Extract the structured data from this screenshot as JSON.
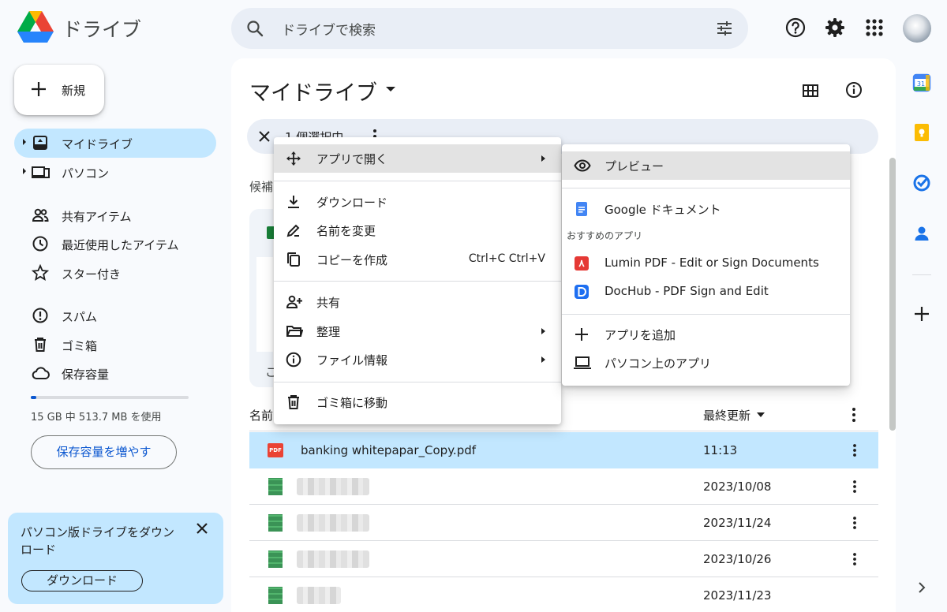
{
  "app": {
    "brand": "ドライブ"
  },
  "search": {
    "placeholder": "ドライブで検索"
  },
  "nav": {
    "new_label": "新規",
    "items": [
      {
        "label": "マイドライブ"
      },
      {
        "label": "パソコン"
      },
      {
        "label": "共有アイテム"
      },
      {
        "label": "最近使用したアイテム"
      },
      {
        "label": "スター付き"
      },
      {
        "label": "スパム"
      },
      {
        "label": "ゴミ箱"
      },
      {
        "label": "保存容量"
      }
    ],
    "storage_used_fraction": 0.033,
    "storage_text": "15 GB 中 513.7 MB を使用",
    "storage_button": "保存容量を増やす"
  },
  "promo": {
    "text": "パソコン版ドライブをダウンロード",
    "button": "ダウンロード"
  },
  "main": {
    "title": "マイドライブ",
    "selection_text": "1 個選択中",
    "suggested_label": "候補",
    "card_text": "こ",
    "col_name": "名前",
    "col_modified": "最終更新",
    "rows": [
      {
        "name": "banking whitepapar_Copy.pdf",
        "date": "11:13",
        "type": "pdf"
      },
      {
        "name": "",
        "date": "2023/10/08",
        "type": "sheet"
      },
      {
        "name": "",
        "date": "2023/11/24",
        "type": "sheet"
      },
      {
        "name": "",
        "date": "2023/10/26",
        "type": "sheet"
      },
      {
        "name": "",
        "date": "2023/11/23",
        "type": "sheet"
      }
    ]
  },
  "context_menu": {
    "open_with": "アプリで開く",
    "download": "ダウンロード",
    "rename": "名前を変更",
    "copy": "コピーを作成",
    "copy_shortcut": "Ctrl+C Ctrl+V",
    "share": "共有",
    "organize": "整理",
    "file_info": "ファイル情報",
    "trash": "ゴミ箱に移動"
  },
  "submenu": {
    "preview": "プレビュー",
    "google_docs": "Google ドキュメント",
    "suggested_header": "おすすめのアプリ",
    "lumin": "Lumin PDF - Edit or Sign Documents",
    "dochub": "DocHub - PDF Sign and Edit",
    "add_app": "アプリを追加",
    "desktop_apps": "パソコン上のアプリ"
  },
  "colors": {
    "accent": "#0b57d0",
    "selected": "#c2e7ff"
  }
}
